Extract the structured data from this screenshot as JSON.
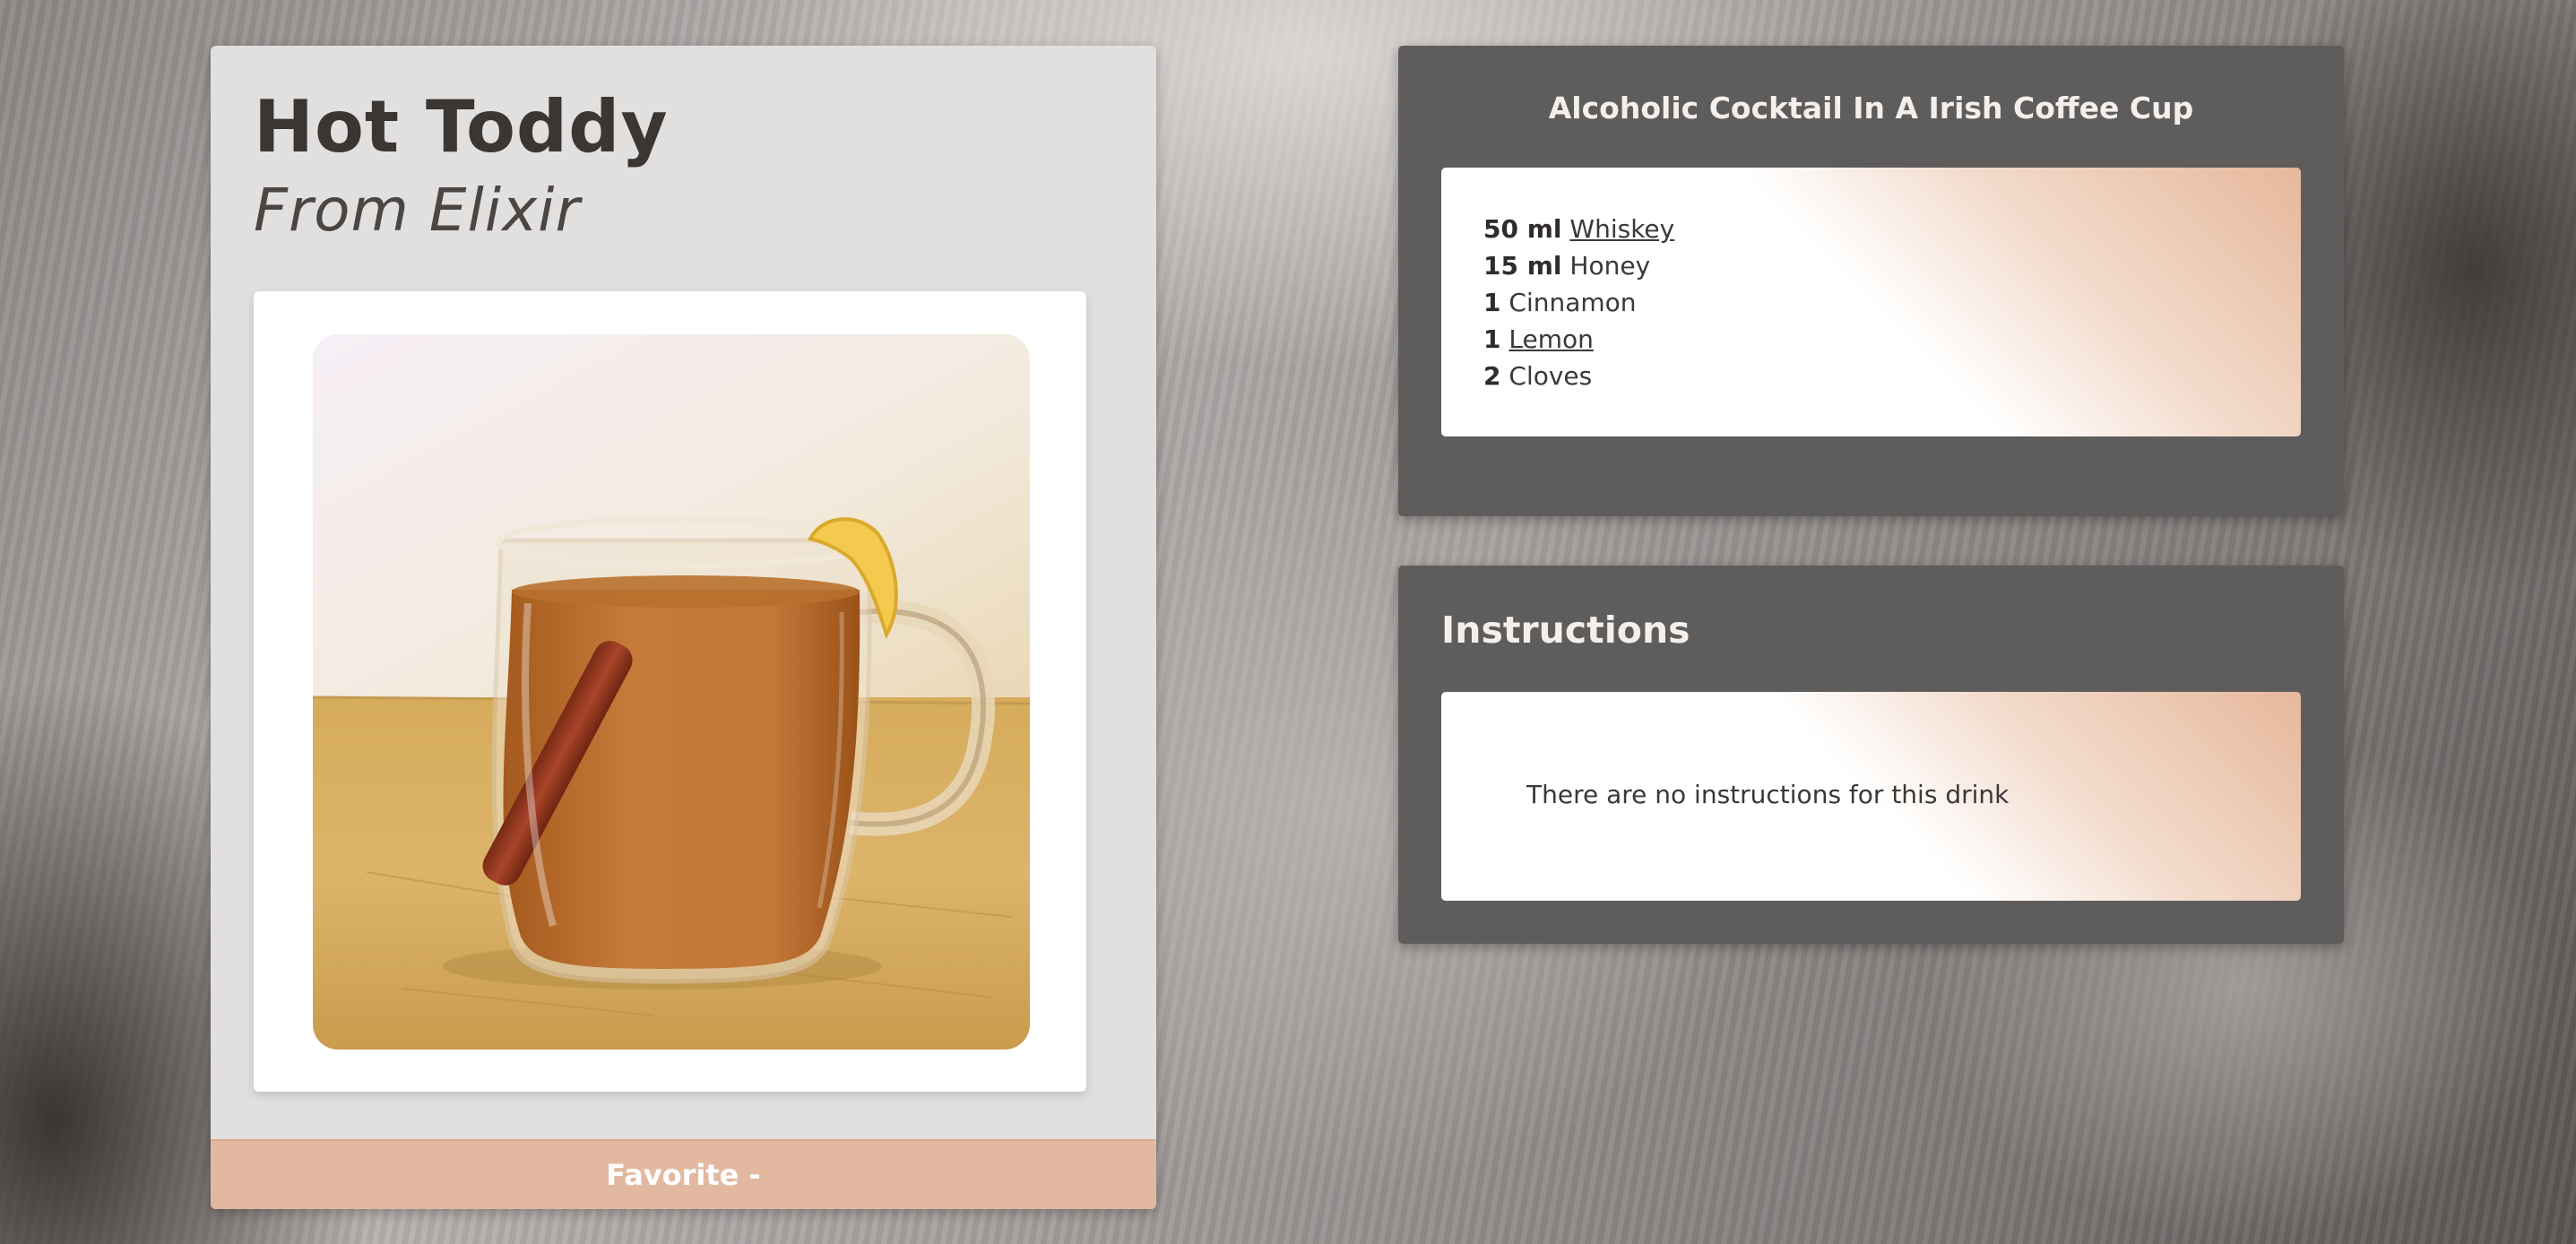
{
  "drink": {
    "name": "Hot Toddy",
    "source": "From Elixir",
    "image_alt": "Hot Toddy",
    "favorite_label": "Favorite -"
  },
  "category": {
    "title": "Alcoholic Cocktail In A Irish Coffee Cup"
  },
  "ingredients": [
    {
      "measure": "50 ml",
      "name": "Whiskey",
      "linked": true
    },
    {
      "measure": "15 ml",
      "name": "Honey",
      "linked": false
    },
    {
      "measure": "1",
      "name": "Cinnamon",
      "linked": false
    },
    {
      "measure": "1",
      "name": "Lemon",
      "linked": true
    },
    {
      "measure": "2",
      "name": "Cloves",
      "linked": false
    }
  ],
  "instructions": {
    "heading": "Instructions",
    "text": "There are no instructions for this drink"
  },
  "colors": {
    "favorite_bar": "#e2b9a0",
    "panel": "#5f5d5c",
    "card": "#e2e0df",
    "gradient_accent": "#e6b89b"
  }
}
